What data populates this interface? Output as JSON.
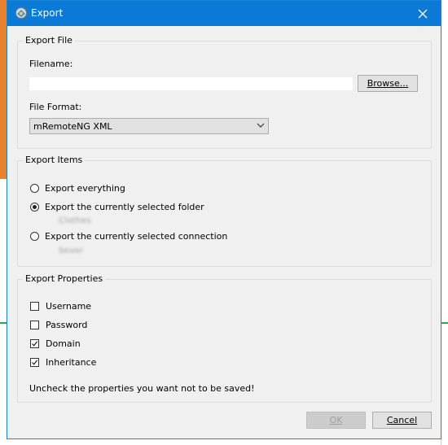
{
  "window": {
    "title": "Export"
  },
  "export_file": {
    "group_title": "Export File",
    "filename_label": "Filename:",
    "filename_value": "",
    "browse_label": "Browse...",
    "format_label": "File Format:",
    "format_value": "mRemoteNG XML"
  },
  "export_items": {
    "group_title": "Export Items",
    "options": [
      {
        "label": "Export everything",
        "checked": false,
        "detail": ""
      },
      {
        "label": "Export the currently selected folder",
        "checked": true,
        "detail": "Clothes"
      },
      {
        "label": "Export the currently selected connection",
        "checked": false,
        "detail": "Sever"
      }
    ]
  },
  "export_properties": {
    "group_title": "Export Properties",
    "properties": [
      {
        "label": "Username",
        "checked": false
      },
      {
        "label": "Password",
        "checked": false
      },
      {
        "label": "Domain",
        "checked": true
      },
      {
        "label": "Inheritance",
        "checked": true
      }
    ],
    "hint": "Uncheck the properties you want not to be saved!"
  },
  "buttons": {
    "ok_label": "OK",
    "cancel_label": "Cancel"
  },
  "colors": {
    "titlebar": "#0b7ad6",
    "dialog_bg": "#f0f0f0"
  }
}
